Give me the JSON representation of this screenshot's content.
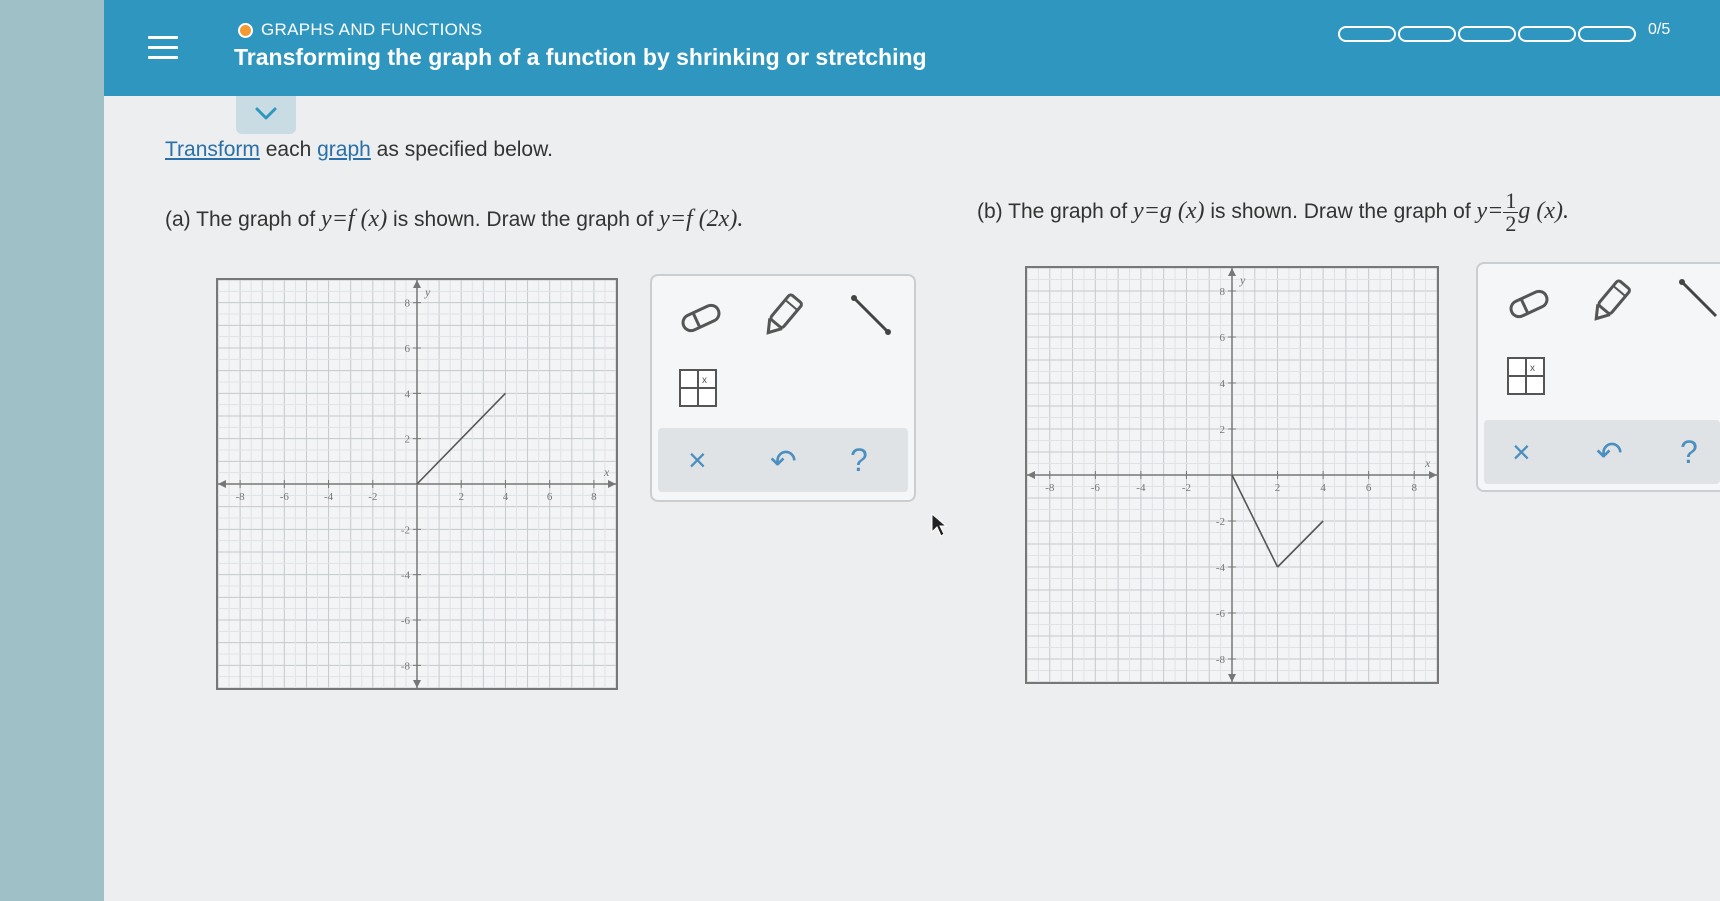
{
  "header": {
    "topic": "GRAPHS AND FUNCTIONS",
    "title": "Transforming the graph of a function by shrinking or stretching",
    "progress_label": "0/5",
    "progress_segments": 5,
    "progress_filled": 0,
    "accent_color": "#2f97bf"
  },
  "instruction": {
    "link1": "Transform",
    "text1": " each ",
    "link2": "graph",
    "text2": " as specified below."
  },
  "part_a": {
    "prefix": "(a)  The graph of ",
    "given_fn": "y=f (x)",
    "middle": " is shown. Draw the graph of ",
    "target_fn": "y=f (2x)."
  },
  "part_b": {
    "prefix": "(b)  The graph of ",
    "given_fn": "y=g (x)",
    "middle": " is shown. Draw the graph of ",
    "target_lhs": "y=",
    "frac_num": "1",
    "frac_den": "2",
    "target_rhs": "g (x)."
  },
  "graph_a": {
    "x_label": "x",
    "y_label": "y",
    "x_ticks": [
      "-8",
      "-6",
      "-4",
      "-2",
      "2",
      "4",
      "6",
      "8"
    ],
    "y_ticks": [
      "8",
      "6",
      "4",
      "2",
      "-2",
      "-4",
      "-6",
      "-8"
    ],
    "range": [
      -9,
      9
    ],
    "segments": [
      [
        [
          0,
          0
        ],
        [
          4,
          4
        ]
      ]
    ]
  },
  "graph_b": {
    "x_label": "x",
    "y_label": "y",
    "x_ticks": [
      "-8",
      "-6",
      "-4",
      "-2",
      "2",
      "4",
      "6",
      "8"
    ],
    "y_ticks": [
      "8",
      "6",
      "4",
      "2",
      "-2",
      "-4",
      "-6",
      "-8"
    ],
    "range": [
      -9,
      9
    ],
    "segments": [
      [
        [
          0,
          0
        ],
        [
          2,
          -4
        ]
      ],
      [
        [
          2,
          -4
        ],
        [
          4,
          -2
        ]
      ]
    ]
  },
  "toolbox": {
    "tools": [
      "eraser-icon",
      "pencil-icon",
      "line-segment-icon",
      "table-grid-icon"
    ],
    "clear_symbol": "×",
    "undo_symbol": "↶",
    "help_symbol": "?"
  }
}
